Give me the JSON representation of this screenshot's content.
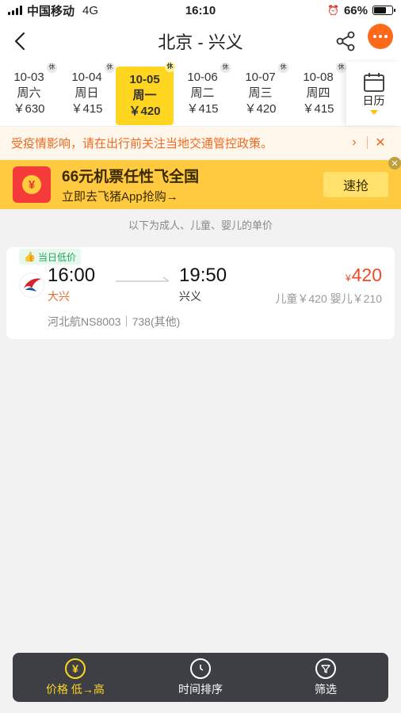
{
  "status_bar": {
    "carrier": "中国移动",
    "network": "4G",
    "time": "16:10",
    "battery_percent": "66%",
    "battery_level": 0.66
  },
  "nav": {
    "title": "北京 - 兴义"
  },
  "dates": [
    {
      "date": "10-03",
      "weekday": "周六",
      "price": "￥630",
      "rest": "休",
      "selected": false
    },
    {
      "date": "10-04",
      "weekday": "周日",
      "price": "￥415",
      "rest": "休",
      "selected": false
    },
    {
      "date": "10-05",
      "weekday": "周一",
      "price": "￥420",
      "rest": "休",
      "selected": true
    },
    {
      "date": "10-06",
      "weekday": "周二",
      "price": "￥415",
      "rest": "休",
      "selected": false
    },
    {
      "date": "10-07",
      "weekday": "周三",
      "price": "￥420",
      "rest": "休",
      "selected": false
    },
    {
      "date": "10-08",
      "weekday": "周四",
      "price": "￥415",
      "rest": "休",
      "selected": false
    }
  ],
  "calendar_label": "日历",
  "notice": {
    "text": "受疫情影响，请在出行前关注当地交通管控政策。"
  },
  "promo": {
    "title": "66元机票任性飞全国",
    "subtitle": "立即去飞猪App抢购→",
    "button": "速抢",
    "icon_symbol": "¥"
  },
  "price_hint": "以下为成人、儿童、婴儿的单价",
  "flight": {
    "badge": "当日低价",
    "dep_time": "16:00",
    "dep_airport": "大兴",
    "arr_time": "19:50",
    "arr_airport": "兴义",
    "price_symbol": "¥",
    "price": "420",
    "sub_prices": "儿童￥420 婴儿￥210",
    "info": "河北航NS8003｜738(其他)"
  },
  "bottom_bar": {
    "items": [
      {
        "label": "价格 低→高",
        "icon": "yuan-icon",
        "active": true
      },
      {
        "label": "时间排序",
        "icon": "clock-icon",
        "active": false
      },
      {
        "label": "筛选",
        "icon": "filter-icon",
        "active": false
      }
    ]
  },
  "colors": {
    "accent": "#ffd51f",
    "price": "#f04a2a",
    "notice": "#f06a22",
    "promo_bg": "#ffc940"
  }
}
